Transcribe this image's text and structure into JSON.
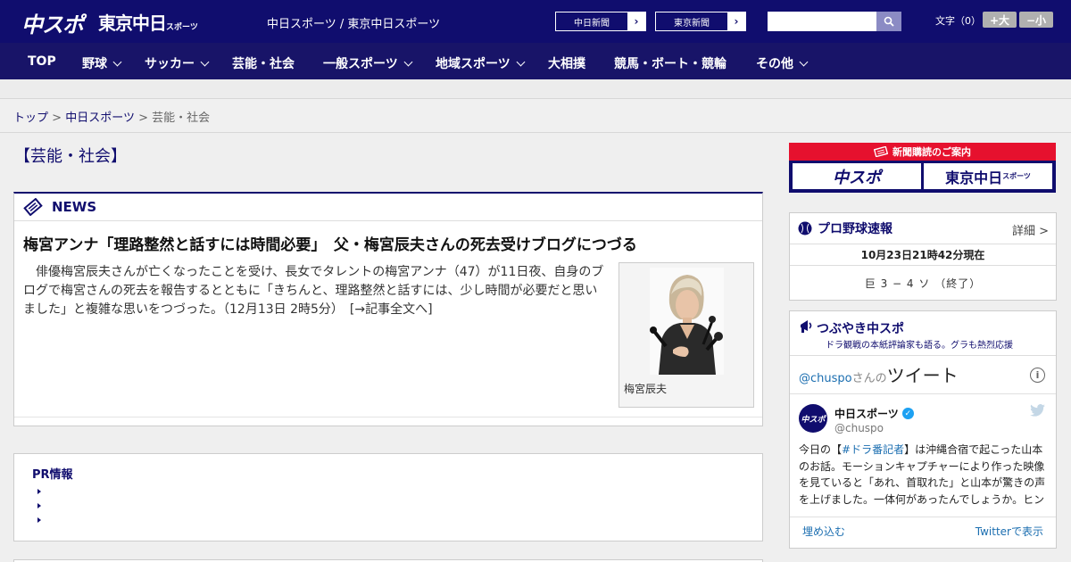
{
  "header": {
    "logo_chuspo": "中スポ",
    "logo_tokyo": "東京中日",
    "logo_tokyo_small": "スポーツ",
    "site_links": "中日スポーツ / 東京中日スポーツ",
    "paper_chunichi": "中日新聞",
    "paper_tokyo": "東京新聞",
    "search_placeholder": "",
    "font_size_label": "文字（0）",
    "font_bigger": "+大",
    "font_smaller": "−小"
  },
  "nav": [
    {
      "label": "TOP"
    },
    {
      "label": "野球"
    },
    {
      "label": "サッカー"
    },
    {
      "label": "芸能・社会"
    },
    {
      "label": "一般スポーツ"
    },
    {
      "label": "地域スポーツ"
    },
    {
      "label": "大相撲"
    },
    {
      "label": "競馬・ボート・競輪"
    },
    {
      "label": "その他"
    }
  ],
  "breadcrumb": {
    "top": "トップ",
    "sep": ">",
    "chunichi": "中日スポーツ",
    "current": "芸能・社会"
  },
  "page_title": "【芸能・社会】",
  "news": {
    "section_label": "NEWS",
    "headline": "梅宮アンナ「理路整然と話すには時間必要」　父・梅宮辰夫さんの死去受けブログにつづる",
    "body": "俳優梅宮辰夫さんが亡くなったことを受け、長女でタレントの梅宮アンナ（47）が11日夜、自身のブログで梅宮さんの死去を報告するとともに「きちんと、理路整然と話すには、少し時間が必要だと思いました」と複雑な思いをつづった。（12月13日 2時5分）　[→記事全文へ]",
    "photo_caption": "梅宮辰夫"
  },
  "pr": {
    "title": "PR情報"
  },
  "subscription": {
    "banner_label": "新聞購読のご案内",
    "chuspo": "中スポ",
    "tokyo": "東京中日",
    "tokyo_small": "スポーツ"
  },
  "baseball": {
    "title": "プロ野球速報",
    "detail": "詳細 >",
    "time": "10月23日21時42分現在",
    "score": "巨 3 − 4 ソ （終了）"
  },
  "tweets": {
    "title": "つぶやき中スポ",
    "subtitle": "ドラ観戦の本紙評論家も語る。グラも熱烈応援",
    "handle": "@chuspo",
    "handle_suffix": "さんの",
    "heading": "ツイート",
    "info": "i",
    "account_name": "中日スポーツ",
    "account_user": "@chuspo",
    "avatar_text": "中スポ",
    "text_before": "今日の【",
    "text_tag": "#ドラ番記者",
    "text_after": "】は沖縄合宿で起こった山本のお話。モーションキャプチャーにより作った映像を見ていると「あれ、首取れた」と山本が驚きの声を上げました。一体何があったんでしょうか。ヒン",
    "embed": "埋め込む",
    "view": "Twitterで表示"
  },
  "colors": {
    "brand_navy": "#100d6e",
    "nav_bg": "#181468",
    "subscription_red": "#e6112e",
    "twitter_blue": "#1da1f2"
  }
}
